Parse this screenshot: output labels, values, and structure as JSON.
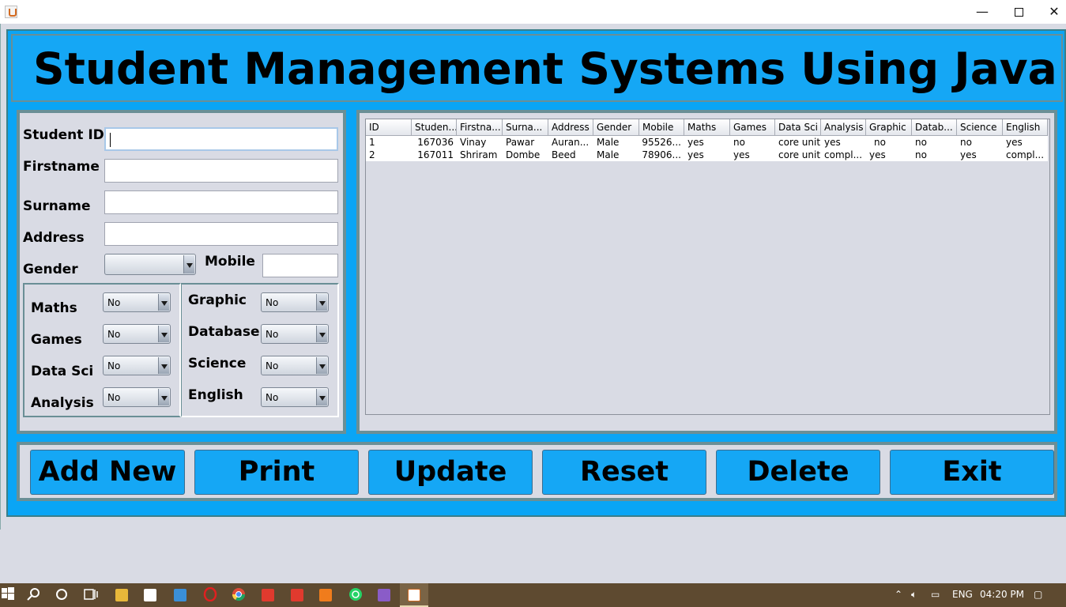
{
  "window": {
    "min": "—",
    "max": "",
    "close": "✕"
  },
  "header": {
    "title": "Student Management Systems Using Java"
  },
  "form": {
    "student_id_label": "Student ID",
    "student_id_value": "",
    "firstname_label": "Firstname",
    "surname_label": "Surname",
    "address_label": "Address",
    "gender_label": "Gender",
    "gender_value": "",
    "mobile_label": "Mobile"
  },
  "subjects_left": [
    {
      "label": "Maths",
      "value": "No"
    },
    {
      "label": "Games",
      "value": "No"
    },
    {
      "label": "Data Sci",
      "value": "No"
    },
    {
      "label": "Analysis",
      "value": "No"
    }
  ],
  "subjects_right": [
    {
      "label": "Graphic",
      "value": "No"
    },
    {
      "label": "Database",
      "value": "No"
    },
    {
      "label": "Science",
      "value": "No"
    },
    {
      "label": "English",
      "value": "No"
    }
  ],
  "table": {
    "headers": [
      "ID",
      "Studen...",
      "Firstna...",
      "Surna...",
      "Address",
      "Gender",
      "Mobile",
      "Maths",
      "Games",
      "Data Sci",
      "Analysis",
      "Graphic",
      "Datab...",
      "Science",
      "English"
    ],
    "rows": [
      [
        "1",
        "167036",
        "Vinay",
        "Pawar",
        "Auran...",
        "Male",
        "95526...",
        "yes",
        "no",
        "core unit",
        "yes",
        "no",
        "no",
        "no",
        "yes"
      ],
      [
        "2",
        "167011",
        "Shriram",
        "Dombe",
        "Beed",
        "Male",
        "78906...",
        "yes",
        "yes",
        "core unit",
        "compl...",
        "yes",
        "no",
        "yes",
        "compl..."
      ]
    ]
  },
  "buttons": {
    "add_new": "Add New",
    "print": "Print",
    "update": "Update",
    "reset": "Reset",
    "delete": "Delete",
    "exit": "Exit"
  },
  "taskbar": {
    "language": "ENG",
    "time": "04:20 PM"
  },
  "colors": {
    "accent": "#15a7f5",
    "panel_bg": "#d9dbe4",
    "border": "#6a8f96",
    "taskbar": "#5e4a30"
  }
}
